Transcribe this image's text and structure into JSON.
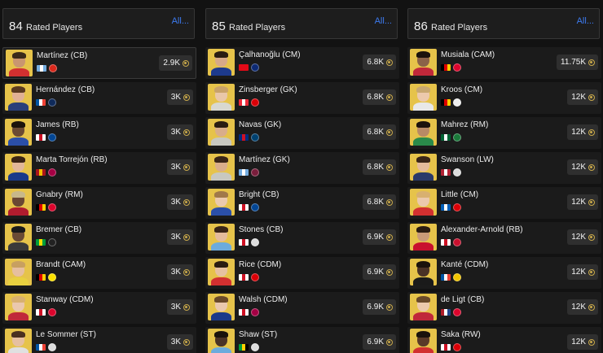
{
  "columns": [
    {
      "rating": "84",
      "label": "Rated Players",
      "all_label": "All...",
      "players": [
        {
          "name": "Martínez (CB)",
          "price": "2.9K",
          "flag": [
            "#74acdf",
            "#ffffff",
            "#74acdf"
          ],
          "club": "#da291c",
          "skin": "#c99670",
          "hair": "#3a2a1a",
          "shirt": "#d23030",
          "selected": true
        },
        {
          "name": "Hernández (CB)",
          "price": "3K",
          "flag": [
            "#0055a4",
            "#ffffff",
            "#ef4135"
          ],
          "club": "#0f2a5a",
          "skin": "#e0b094",
          "hair": "#5a3a20",
          "shirt": "#2a3f7a"
        },
        {
          "name": "James (RB)",
          "price": "3K",
          "flag": [
            "#ffffff",
            "#ce1124",
            "#ffffff"
          ],
          "club": "#034694",
          "skin": "#6b4a33",
          "hair": "#1c130c",
          "shirt": "#2b4fa8"
        },
        {
          "name": "Marta Torrejón (RB)",
          "price": "3K",
          "flag": [
            "#aa151b",
            "#f1bf00",
            "#aa151b"
          ],
          "club": "#a50044",
          "skin": "#e2b798",
          "hair": "#3a2414",
          "shirt": "#1a3a8a"
        },
        {
          "name": "Gnabry (RM)",
          "price": "3K",
          "flag": [
            "#000000",
            "#dd0000",
            "#ffce00"
          ],
          "club": "#dc052d",
          "skin": "#6a4733",
          "hair": "#c8b88a",
          "shirt": "#b01c2e"
        },
        {
          "name": "Bremer (CB)",
          "price": "3K",
          "flag": [
            "#009c3b",
            "#ffdf00",
            "#009c3b"
          ],
          "club": "#222222",
          "skin": "#6a4a35",
          "hair": "#1a1a1a",
          "shirt": "#3a3a3a"
        },
        {
          "name": "Brandt (CAM)",
          "price": "3K",
          "flag": [
            "#000000",
            "#dd0000",
            "#ffce00"
          ],
          "club": "#fde100",
          "skin": "#e6bf9f",
          "hair": "#c8a060",
          "shirt": "#e8d040"
        },
        {
          "name": "Stanway (CDM)",
          "price": "3K",
          "flag": [
            "#ffffff",
            "#ce1124",
            "#ffffff"
          ],
          "club": "#dc052d",
          "skin": "#eac8ad",
          "hair": "#d8b070",
          "shirt": "#c0283a"
        },
        {
          "name": "Le Sommer (ST)",
          "price": "3K",
          "flag": [
            "#0055a4",
            "#ffffff",
            "#ef4135"
          ],
          "club": "#dddddd",
          "skin": "#e6c0a0",
          "hair": "#4a3020",
          "shirt": "#e0e0e0"
        }
      ]
    },
    {
      "rating": "85",
      "label": "Rated Players",
      "all_label": "All...",
      "players": [
        {
          "name": "Çalhanoğlu (CM)",
          "price": "6.8K",
          "flag": [
            "#e30a17",
            "#e30a17",
            "#e30a17"
          ],
          "club": "#0d2a74",
          "skin": "#d7a988",
          "hair": "#2a1c12",
          "shirt": "#1d3a8c"
        },
        {
          "name": "Zinsberger (GK)",
          "price": "6.8K",
          "flag": [
            "#ed2939",
            "#ffffff",
            "#ed2939"
          ],
          "club": "#db0007",
          "skin": "#e9c7a9",
          "hair": "#c9a36a",
          "shirt": "#d8d8d0"
        },
        {
          "name": "Navas (GK)",
          "price": "6.8K",
          "flag": [
            "#002b7f",
            "#ce1126",
            "#002b7f"
          ],
          "club": "#004170",
          "skin": "#d9ad8a",
          "hair": "#2a1c12",
          "shirt": "#c8c8c0"
        },
        {
          "name": "Martínez (GK)",
          "price": "6.8K",
          "flag": [
            "#74acdf",
            "#ffffff",
            "#74acdf"
          ],
          "club": "#7a1e3c",
          "skin": "#d9ad8a",
          "hair": "#3a2618",
          "shirt": "#c8c8c0"
        },
        {
          "name": "Bright (CB)",
          "price": "6.8K",
          "flag": [
            "#ffffff",
            "#ce1124",
            "#ffffff"
          ],
          "club": "#034694",
          "skin": "#ebc9ad",
          "hair": "#a0784a",
          "shirt": "#2b4fa8"
        },
        {
          "name": "Stones (CB)",
          "price": "6.9K",
          "flag": [
            "#ffffff",
            "#ce1124",
            "#ffffff"
          ],
          "club": "#dddddd",
          "skin": "#e4bb9b",
          "hair": "#3a2618",
          "shirt": "#6cabdd"
        },
        {
          "name": "Rice (CDM)",
          "price": "6.9K",
          "flag": [
            "#ffffff",
            "#ce1124",
            "#ffffff"
          ],
          "club": "#db0007",
          "skin": "#e6c0a0",
          "hair": "#2a1c12",
          "shirt": "#d23030"
        },
        {
          "name": "Walsh (CDM)",
          "price": "6.9K",
          "flag": [
            "#ffffff",
            "#ce1124",
            "#ffffff"
          ],
          "club": "#a50044",
          "skin": "#eac8ad",
          "hair": "#6a4a2a",
          "shirt": "#1a3a8a"
        },
        {
          "name": "Shaw (ST)",
          "price": "6.9K",
          "flag": [
            "#009b3a",
            "#fed100",
            "#000000"
          ],
          "club": "#dddddd",
          "skin": "#4a3226",
          "hair": "#1a120c",
          "shirt": "#6cabdd"
        }
      ]
    },
    {
      "rating": "86",
      "label": "Rated Players",
      "all_label": "All...",
      "players": [
        {
          "name": "Musiala (CAM)",
          "price": "11.75K",
          "flag": [
            "#000000",
            "#dd0000",
            "#ffce00"
          ],
          "club": "#dc052d",
          "skin": "#8a6248",
          "hair": "#1a120c",
          "shirt": "#c0283a"
        },
        {
          "name": "Kroos (CM)",
          "price": "12K",
          "flag": [
            "#000000",
            "#dd0000",
            "#ffce00"
          ],
          "club": "#eeeeee",
          "skin": "#ecc9ac",
          "hair": "#c8a870",
          "shirt": "#e8e8e8"
        },
        {
          "name": "Mahrez (RM)",
          "price": "12K",
          "flag": [
            "#006233",
            "#ffffff",
            "#006233"
          ],
          "club": "#1a7a3a",
          "skin": "#b88a66",
          "hair": "#1a120c",
          "shirt": "#2a8a4a"
        },
        {
          "name": "Swanson (LW)",
          "price": "12K",
          "flag": [
            "#b22234",
            "#ffffff",
            "#b22234"
          ],
          "club": "#dddddd",
          "skin": "#e4bb9b",
          "hair": "#3a2618",
          "shirt": "#2a3a6a"
        },
        {
          "name": "Little (CM)",
          "price": "12K",
          "flag": [
            "#005eb8",
            "#ffffff",
            "#005eb8"
          ],
          "club": "#db0007",
          "skin": "#ebc9ad",
          "hair": "#d8b070",
          "shirt": "#d23030"
        },
        {
          "name": "Alexander-Arnold (RB)",
          "price": "12K",
          "flag": [
            "#ffffff",
            "#ce1124",
            "#ffffff"
          ],
          "club": "#c8102e",
          "skin": "#c99a78",
          "hair": "#2a1c12",
          "shirt": "#c8102e"
        },
        {
          "name": "Kanté (CDM)",
          "price": "12K",
          "flag": [
            "#0055a4",
            "#ffffff",
            "#ef4135"
          ],
          "club": "#f2c500",
          "skin": "#4a3226",
          "hair": "#1a120c",
          "shirt": "#1a1a1a"
        },
        {
          "name": "de Ligt (CB)",
          "price": "12K",
          "flag": [
            "#ae1c28",
            "#ffffff",
            "#21468b"
          ],
          "club": "#dc052d",
          "skin": "#ecc9ac",
          "hair": "#6a4a2a",
          "shirt": "#c0283a"
        },
        {
          "name": "Saka (RW)",
          "price": "12K",
          "flag": [
            "#ffffff",
            "#ce1124",
            "#ffffff"
          ],
          "club": "#db0007",
          "skin": "#5a3a28",
          "hair": "#1a120c",
          "shirt": "#d23030"
        }
      ]
    }
  ]
}
